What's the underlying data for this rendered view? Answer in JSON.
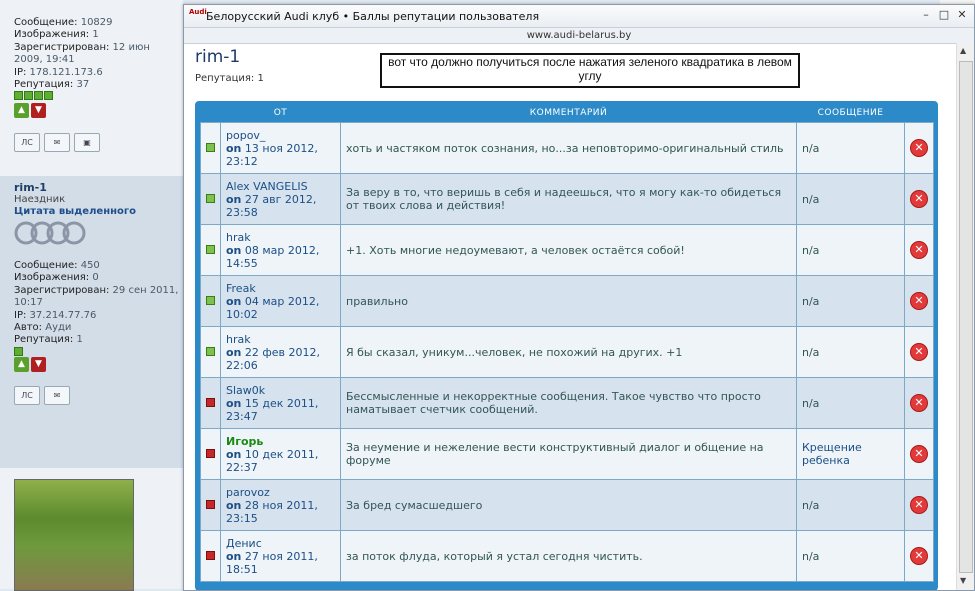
{
  "background": {
    "profile_top": {
      "stats": [
        {
          "label": "Сообщение:",
          "value": "10829"
        },
        {
          "label": "Изображения:",
          "value": "1"
        },
        {
          "label": "Зарегистрирован:",
          "value": "12 июн 2009, 19:41"
        },
        {
          "label": "IP:",
          "value": "178.121.173.6"
        },
        {
          "label": "Репутация:",
          "value": "37"
        }
      ]
    },
    "profile_rim": {
      "username": "rim-1",
      "rank": "Наездник",
      "quote_link": "Цитата выделенного",
      "stats": [
        {
          "label": "Сообщение:",
          "value": "450"
        },
        {
          "label": "Изображения:",
          "value": "0"
        },
        {
          "label": "Зарегистрирован:",
          "value": "29 сен 2011, 10:17"
        },
        {
          "label": "IP:",
          "value": "37.214.77.76"
        },
        {
          "label": "Авто:",
          "value": "Ауди"
        },
        {
          "label": "Репутация:",
          "value": "1"
        }
      ]
    },
    "pm_button": "ЛС"
  },
  "window": {
    "logo_text": "Audi",
    "title": "Белорусский Audi клуб • Баллы репутации пользователя",
    "url": "www.audi-belarus.by",
    "controls": {
      "minimize": "–",
      "maximize": "□",
      "close": "✕"
    }
  },
  "page": {
    "username": "rim-1",
    "reputation": "Репутация: 1",
    "note": "вот что должно получиться после нажатия зеленого квадратика в левом углу"
  },
  "table": {
    "headers": {
      "from": "ОТ",
      "comment": "КОММЕНТАРИЙ",
      "message": "СООБЩЕНИЕ"
    },
    "rows": [
      {
        "type": "positive",
        "name": "popov_",
        "on": "on",
        "date": "13 ноя 2012, 23:12",
        "comment": "хоть и частяком поток сознания, но...за неповторимо-оригинальный стиль",
        "message": "n/a"
      },
      {
        "type": "positive",
        "name": "Alex VANGELIS",
        "on": "on",
        "date": "27 авг 2012, 23:58",
        "comment": "За веру в то, что веришь в себя и надеешься, что я могу как-то обидеться от твоих слова и действия!",
        "message": "n/a"
      },
      {
        "type": "positive",
        "name": "hrak",
        "on": "on",
        "date": "08 мар 2012, 14:55",
        "comment": "+1. Хоть многие недоумевают, а человек остаётся собой!",
        "message": "n/a"
      },
      {
        "type": "positive",
        "name": "Freak",
        "on": "on",
        "date": "04 мар 2012, 10:02",
        "comment": "правильно",
        "message": "n/a"
      },
      {
        "type": "positive",
        "name": "hrak",
        "on": "on",
        "date": "22 фев 2012, 22:06",
        "comment": "Я бы сказал, уникум...человек, не похожий на других. +1",
        "message": "n/a"
      },
      {
        "type": "negative",
        "name": "Slaw0k",
        "on": "on",
        "date": "15 дек 2011, 23:47",
        "comment": "Бессмысленные и некорректные сообщения. Такое чувство что просто наматывает счетчик сообщений.",
        "message": "n/a"
      },
      {
        "type": "negative",
        "name": "Игорь",
        "on": "on",
        "date": "10 дек 2011, 22:37",
        "comment": "За неумение и нежеление вести конструктивный диалог и общение на форуме",
        "message": "Крещение ребенка"
      },
      {
        "type": "negative",
        "name": "parovoz",
        "on": "on",
        "date": "28 ноя 2011, 23:15",
        "comment": "За бред сумасшедшего",
        "message": "n/a"
      },
      {
        "type": "negative",
        "name": "Денис",
        "on": "on",
        "date": "27 ноя 2011, 18:51",
        "comment": "за поток флуда, который я устал сегодня чистить.",
        "message": "n/a"
      }
    ]
  },
  "colors": {
    "positive": "#7ec24c",
    "negative": "#c42828",
    "header": "#2b8ac7",
    "delete": "#e23a3a"
  }
}
